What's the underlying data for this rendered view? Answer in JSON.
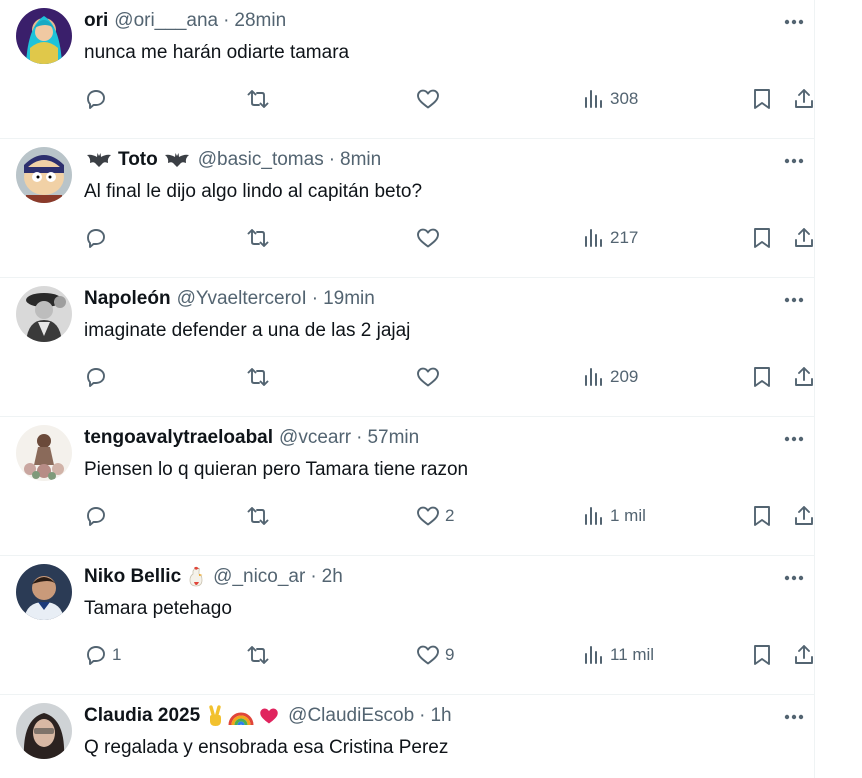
{
  "tweets": [
    {
      "display_name": "ori",
      "handle": "@ori___ana",
      "time": "28min",
      "text": "nunca me harán odiarte tamara",
      "replies": "",
      "likes": "",
      "views": "308",
      "avatar": "blue-haired-character-avatar"
    },
    {
      "display_name": "Toto",
      "name_badge": "🦇",
      "handle": "@basic_tomas",
      "time": "8min",
      "text": "Al final le dijo algo lindo al capitán beto?",
      "replies": "",
      "likes": "",
      "views": "217",
      "avatar": "cartoon-character-avatar"
    },
    {
      "display_name": "Napoleón",
      "handle": "@YvaelterceroI",
      "time": "19min",
      "text": "imaginate defender a una de las 2 jajaj",
      "replies": "",
      "likes": "",
      "views": "209",
      "avatar": "grayscale-portrait-avatar"
    },
    {
      "display_name": "tengoavalytraeloabal",
      "handle": "@vcearr",
      "time": "57min",
      "text": "Piensen lo q quieran pero Tamara tiene razon",
      "replies": "",
      "likes": "2",
      "views": "1 mil",
      "avatar": "floral-figure-avatar"
    },
    {
      "display_name": "Niko Bellic",
      "name_emoji": "🐓",
      "handle": "@_nico_ar",
      "time": "2h",
      "text": "Tamara petehago",
      "replies": "1",
      "likes": "9",
      "views": "11 mil",
      "avatar": "footballer-portrait-avatar"
    },
    {
      "display_name": "Claudia 2025",
      "name_emojis": "✌🌈❤",
      "handle": "@ClaudiEscob",
      "time": "1h",
      "text": "Q regalada y ensobrada esa Cristina Perez",
      "avatar": "woman-portrait-avatar"
    }
  ],
  "separator": "·",
  "icons": {
    "reply": "reply-icon",
    "retweet": "retweet-icon",
    "like": "heart-icon",
    "views": "views-bar-chart-icon",
    "bookmark": "bookmark-icon",
    "share": "share-icon",
    "more": "more-dots-icon"
  },
  "colors": {
    "text": "#0f1419",
    "secondary": "#536471",
    "border": "#eff3f4",
    "heart_emoji": "#e0245e"
  }
}
